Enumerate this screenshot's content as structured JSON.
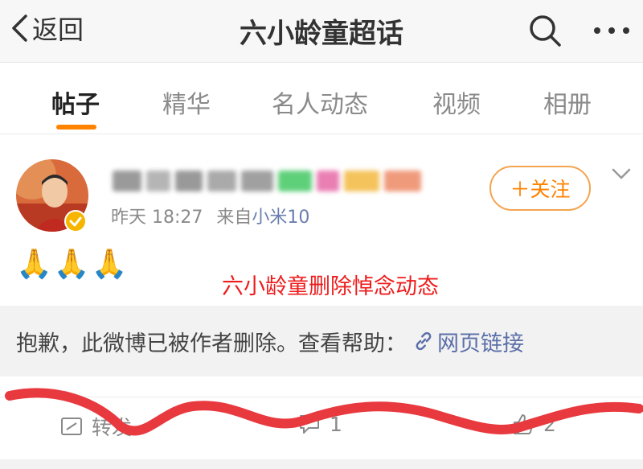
{
  "header": {
    "back_label": "返回",
    "title": "六小龄童超话"
  },
  "tabs": [
    {
      "label": "帖子",
      "active": true
    },
    {
      "label": "精华",
      "active": false
    },
    {
      "label": "名人动态",
      "active": false
    },
    {
      "label": "视频",
      "active": false
    },
    {
      "label": "相册",
      "active": false
    }
  ],
  "post": {
    "username": "",
    "time": "昨天 18:27",
    "source_prefix": "来自",
    "source": "小米10",
    "follow_label": "＋关注",
    "text": "🙏🙏🙏"
  },
  "annotation": "六小龄童删除悼念动态",
  "deleted_notice": {
    "message": "抱歉，此微博已被作者删除。查看帮助：",
    "link": "网页链接"
  },
  "actions": {
    "repost_label": "转发",
    "comment_count": "1",
    "like_count": "2"
  },
  "colors": {
    "accent": "#ff8200",
    "link": "#5b6fa8",
    "annotation": "#ee1c1c",
    "scribble": "#e8393f"
  }
}
